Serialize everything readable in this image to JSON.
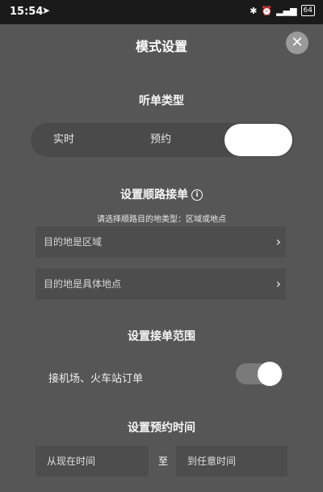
{
  "status_bar": {
    "time": "15:54",
    "battery": "64"
  },
  "header": {
    "title": "模式设置",
    "close_icon": "close-icon"
  },
  "order_type": {
    "title": "听单类型",
    "options": [
      "实时",
      "预约",
      ""
    ],
    "selected_index": 2
  },
  "route": {
    "title": "设置顺路接单",
    "subtitle": "请选择顺路目的地类型：区域或地点",
    "rows": [
      "目的地是区域",
      "目的地是具体地点"
    ]
  },
  "range": {
    "title": "设置接单范围",
    "airport_label": "接机场、火车站订单",
    "airport_enabled": true
  },
  "booking_time": {
    "title": "设置预约时间",
    "from": "从现在时间",
    "to_label": "至",
    "to": "到任意时间"
  },
  "colors": {
    "background": "#565656",
    "panel": "#4d4d4d",
    "statusbar": "#1a1a1a"
  }
}
